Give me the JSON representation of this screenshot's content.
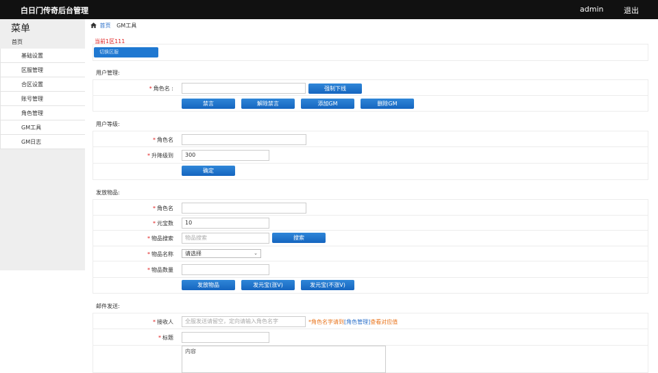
{
  "header": {
    "title": "白日门传奇后台管理",
    "user": "admin",
    "logout": "退出"
  },
  "sidebar": {
    "title": "菜单",
    "home": "首页",
    "items": [
      {
        "label": "基础设置"
      },
      {
        "label": "区服管理"
      },
      {
        "label": "合区设置"
      },
      {
        "label": "账号管理"
      },
      {
        "label": "角色管理"
      },
      {
        "label": "GM工具"
      },
      {
        "label": "GM日志"
      }
    ]
  },
  "breadcrumb": {
    "home": "首页",
    "current": "GM工具"
  },
  "server": {
    "current_label": "当前1区111",
    "select_button": "切换区服"
  },
  "user_mgmt": {
    "title": "用户管理:",
    "role_label": "角色名 :",
    "role_value": "",
    "kick": "强制下线",
    "mute": "禁言",
    "unmute": "解除禁言",
    "add_gm": "添加GM",
    "remove_gm": "删除GM"
  },
  "user_level": {
    "title": "用户等级:",
    "role_label": "角色名",
    "role_value": "",
    "level_label": "升降级到",
    "level_value": "300",
    "confirm": "确定"
  },
  "items": {
    "title": "发放物品:",
    "role_label": "角色名",
    "role_value": "",
    "ingot_label": "元宝数",
    "ingot_value": "10",
    "search_label": "物品搜索",
    "search_placeholder": "物品搜索",
    "search_button": "搜索",
    "name_label": "物品名称",
    "name_selected": "请选择",
    "qty_label": "物品数量",
    "qty_value": "",
    "send_item": "发放物品",
    "send_ingot_v": "发元宝(涨V)",
    "send_ingot_nov": "发元宝(不涨V)"
  },
  "mail": {
    "title": "邮件发送:",
    "recipient_label": "接收人",
    "recipient_placeholder": "全服发送请留空，定向请输入角色名字",
    "note_prefix": "*角色名字请到",
    "note_link": "[角色管理]",
    "note_suffix": "查看对应值",
    "subject_label": "标题",
    "subject_value": "",
    "body_placeholder": "内容"
  },
  "colors": {
    "header_bg": "#111111",
    "button": "#1f78d1",
    "required": "#e02020",
    "note": "#e8731a",
    "link": "#2a6fc9"
  }
}
